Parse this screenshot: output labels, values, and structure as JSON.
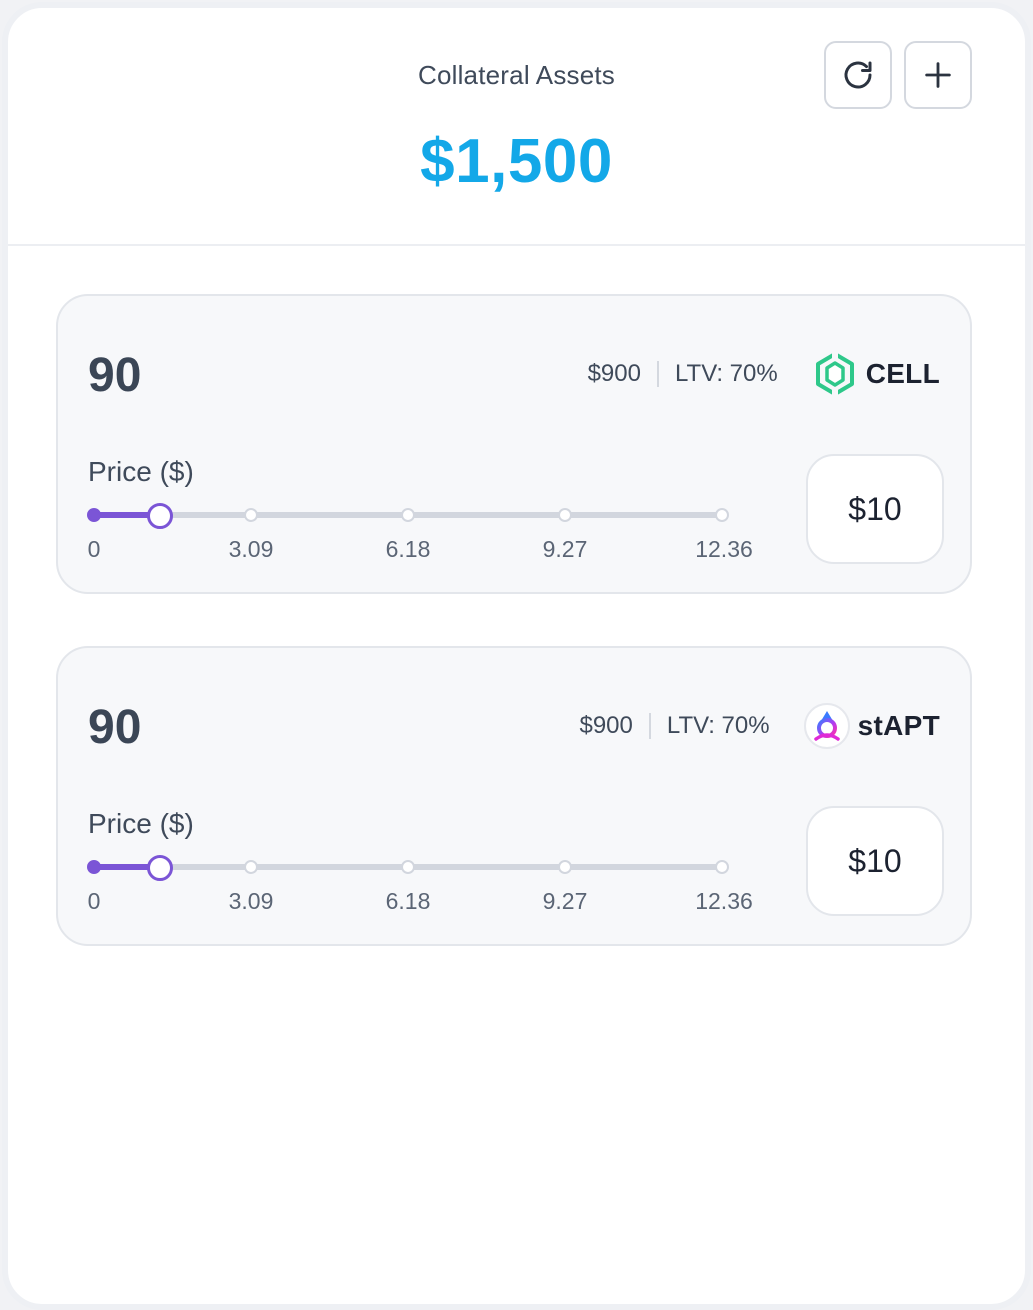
{
  "header": {
    "title": "Collateral Assets",
    "total": "$1,500",
    "refresh_icon": "refresh-icon",
    "add_icon": "plus-icon"
  },
  "slider_ticks": [
    "0",
    "3.09",
    "6.18",
    "9.27",
    "12.36"
  ],
  "slider_max": 12.36,
  "cards": [
    {
      "amount": "90",
      "usd_value": "$900",
      "ltv": "LTV: 70%",
      "token": "CELL",
      "token_icon": "cell-logo-icon",
      "price_label": "Price ($)",
      "price": "$10",
      "slider_value": 1.3
    },
    {
      "amount": "90",
      "usd_value": "$900",
      "ltv": "LTV: 70%",
      "token": "stAPT",
      "token_icon": "stapt-logo-icon",
      "price_label": "Price ($)",
      "price": "$10",
      "slider_value": 1.3
    }
  ],
  "colors": {
    "accent": "#13a8e8",
    "slider": "#7b55d6",
    "cell_green": "#2ec88a"
  }
}
